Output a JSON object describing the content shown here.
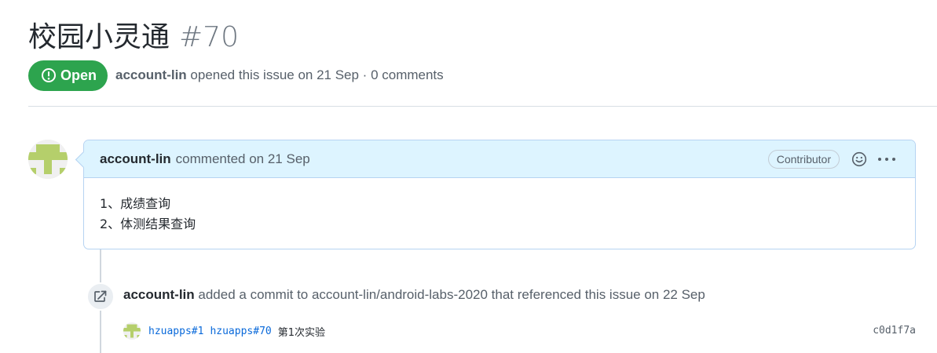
{
  "issue": {
    "title": "校园小灵通",
    "number": "#70",
    "state": "Open",
    "author": "account-lin",
    "meta": " opened this issue on 21 Sep · 0 comments"
  },
  "comment": {
    "author": "account-lin",
    "date": "commented on 21 Sep",
    "badge": "Contributor",
    "body": [
      "1、成绩查询",
      "2、体测结果查询"
    ]
  },
  "event": {
    "author": "account-lin",
    "text": " added a commit to account-lin/android-labs-2020 that referenced this issue on 22 Sep"
  },
  "commit": {
    "ref1": "hzuapps#1",
    "ref2": "hzuapps#70",
    "message": "第1次实验",
    "sha": "c0d1f7a"
  },
  "colors": {
    "open_green": "#2da44e",
    "link_blue": "#0969da",
    "header_blue": "#ddf4ff",
    "avatar_green": "#b5cf6b"
  },
  "icons": {
    "state": "issue-opened-icon",
    "emoji": "smiley-icon",
    "more": "kebab-horizontal-icon",
    "event": "repo-push-icon"
  }
}
